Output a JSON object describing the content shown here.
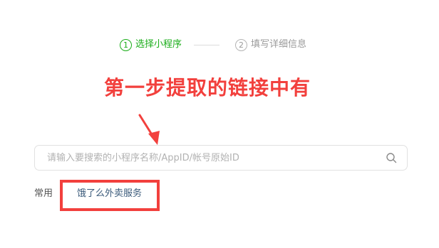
{
  "steps": [
    {
      "number": "1",
      "label": "选择小程序",
      "state": "active"
    },
    {
      "number": "2",
      "label": "填写详细信息",
      "state": "inactive"
    }
  ],
  "annotation": {
    "text": "第一步提取的链接中有",
    "color": "#f2403d"
  },
  "search": {
    "placeholder": "请输入要搜索的小程序名称/AppID/帐号原始ID",
    "value": "",
    "icon": "search-icon"
  },
  "common": {
    "label": "常用",
    "items": [
      {
        "label": "饿了么外卖服务"
      }
    ]
  },
  "colors": {
    "accent": "#1aad19",
    "annotation_red": "#f2403d",
    "inactive": "#9a9a9a",
    "link": "#3a5a7a"
  }
}
